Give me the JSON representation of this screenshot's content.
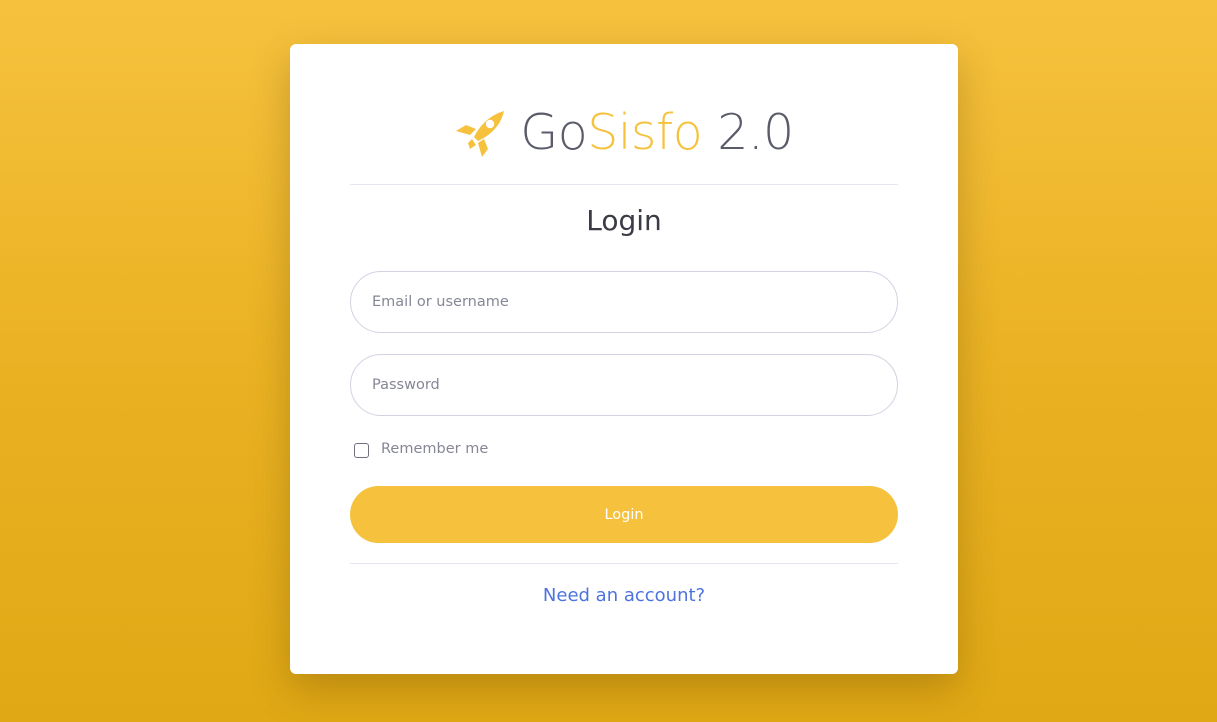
{
  "brand": {
    "icon": "rocket-icon",
    "name_part1": "Go",
    "name_part2": "Sisfo",
    "name_part3": " 2.0",
    "accent_color": "#f6c23e",
    "text_color": "#5a5c69"
  },
  "form": {
    "title": "Login",
    "email_placeholder": "Email or username",
    "email_value": "",
    "password_placeholder": "Password",
    "password_value": "",
    "remember_label": "Remember me",
    "remember_checked": false,
    "submit_label": "Login"
  },
  "footer": {
    "register_link": "Need an account?"
  },
  "colors": {
    "background": "#f6c23e",
    "button": "#f6c23e",
    "link": "#4e73df"
  }
}
